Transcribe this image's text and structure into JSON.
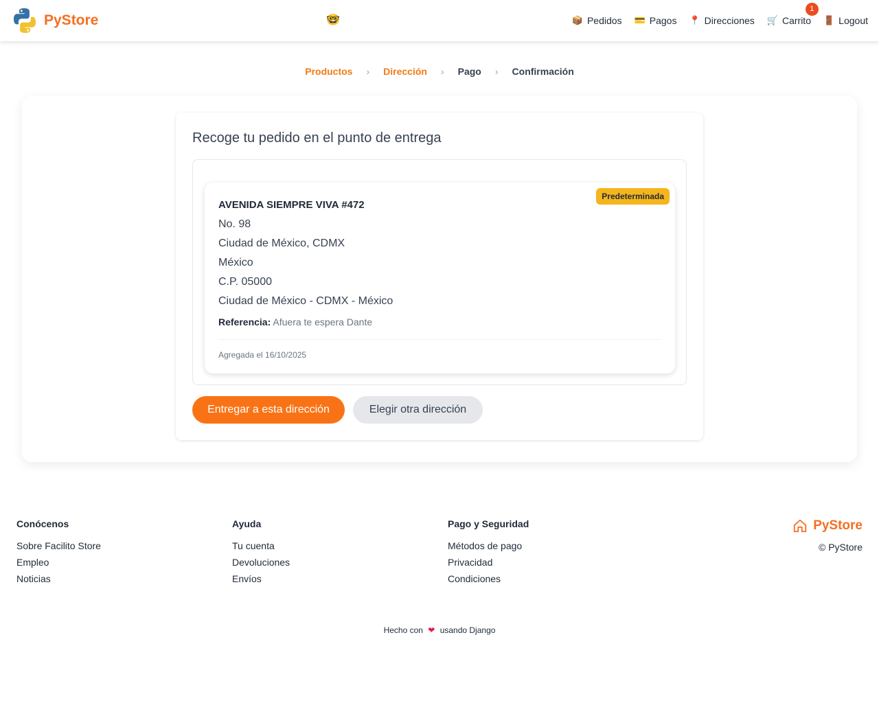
{
  "header": {
    "brand": "PyStore",
    "nav": [
      {
        "label": "Pedidos",
        "icon": "package-icon"
      },
      {
        "label": "Pagos",
        "icon": "credit-card-icon"
      },
      {
        "label": "Direcciones",
        "icon": "pin-icon"
      },
      {
        "label": "Carrito",
        "icon": "cart-icon",
        "badge": "1"
      },
      {
        "label": "Logout",
        "icon": "door-icon"
      }
    ]
  },
  "steps": [
    "Productos",
    "Dirección",
    "Pago",
    "Confirmación"
  ],
  "main": {
    "title": "Recoge tu pedido en el punto de entrega",
    "address": {
      "badge": "Predeterminada",
      "street": "AVENIDA SIEMPRE VIVA #472",
      "number": "No. 98",
      "city_state": "Ciudad de México, CDMX",
      "country": "México",
      "postal": "C.P. 05000",
      "full": "Ciudad de México - CDMX - México",
      "reference_label": "Referencia:",
      "reference": "Afuera te espera Dante",
      "added": "Agregada el 16/10/2025"
    },
    "primary_button": "Entregar a esta dirección",
    "secondary_button": "Elegir otra dirección"
  },
  "footer": {
    "cols": [
      {
        "title": "Conócenos",
        "links": [
          "Sobre Facilito Store",
          "Empleo",
          "Noticias"
        ]
      },
      {
        "title": "Ayuda",
        "links": [
          "Tu cuenta",
          "Devoluciones",
          "Envíos"
        ]
      },
      {
        "title": "Pago y Seguridad",
        "links": [
          "Métodos de pago",
          "Privacidad",
          "Condiciones"
        ]
      }
    ],
    "brand": "PyStore",
    "copyright": "© PyStore",
    "made_prefix": "Hecho con",
    "made_suffix": "usando Django"
  },
  "colors": {
    "accent": "#f97316",
    "brand": "#f46f21",
    "badge": "#f5b51c"
  }
}
